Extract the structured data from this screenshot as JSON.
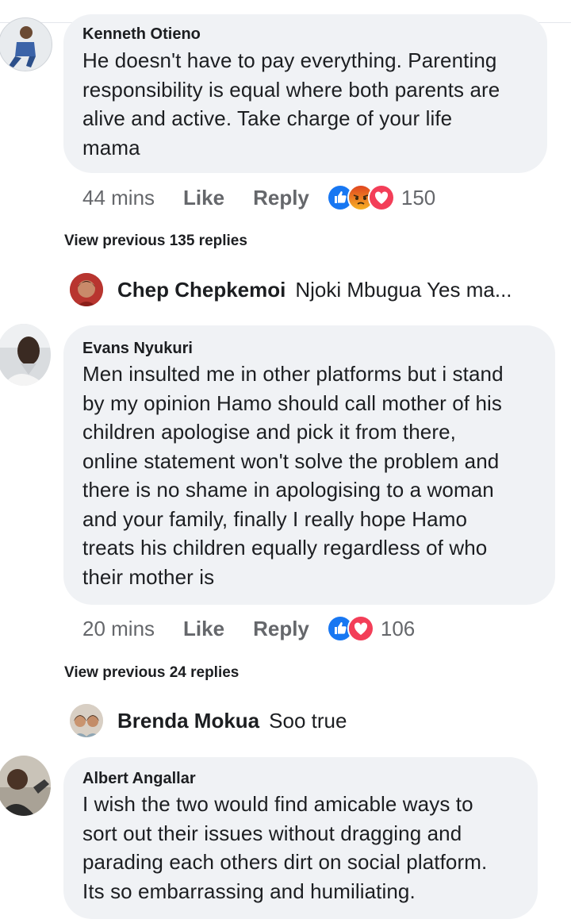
{
  "comments": [
    {
      "author": "Kenneth Otieno",
      "text": [
        "He doesn't have to pay everything. Parenting",
        "responsibility is equal where both parents are",
        "alive and active. Take charge of your life",
        "mama"
      ],
      "time": "44 mins",
      "like_label": "Like",
      "reply_label": "Reply",
      "reactions": [
        "like",
        "angry",
        "love"
      ],
      "reaction_count": "150",
      "view_previous": "View previous 135 replies",
      "latest_reply": {
        "author": "Chep Chepkemoi",
        "text": "Njoki Mbugua Yes ma..."
      }
    },
    {
      "author": "Evans Nyukuri",
      "text": [
        "Men insulted me in other platforms but i stand",
        "by my opinion Hamo should call mother of his",
        "children apologise and pick it from there,",
        "online statement won't solve the problem and",
        "there is no shame in apologising to a woman",
        "and your family, finally I really hope Hamo",
        "treats his children equally regardless of who",
        "their mother is"
      ],
      "time": "20 mins",
      "like_label": "Like",
      "reply_label": "Reply",
      "reactions": [
        "like",
        "love"
      ],
      "reaction_count": "106",
      "view_previous": "View previous 24 replies",
      "latest_reply": {
        "author": "Brenda Mokua",
        "text": "Soo true"
      }
    },
    {
      "author": "Albert Angallar",
      "text": [
        "I wish the two would find amicable ways to",
        "sort out their issues without dragging and",
        "parading each others dirt on social platform.",
        "Its so embarrassing and humiliating."
      ]
    }
  ],
  "colors": {
    "bubble": "#f0f2f5",
    "meta_text": "#65676b",
    "like_blue": "#1877f2",
    "love_red": "#f33e58",
    "angry_orange": "#e9710f"
  }
}
